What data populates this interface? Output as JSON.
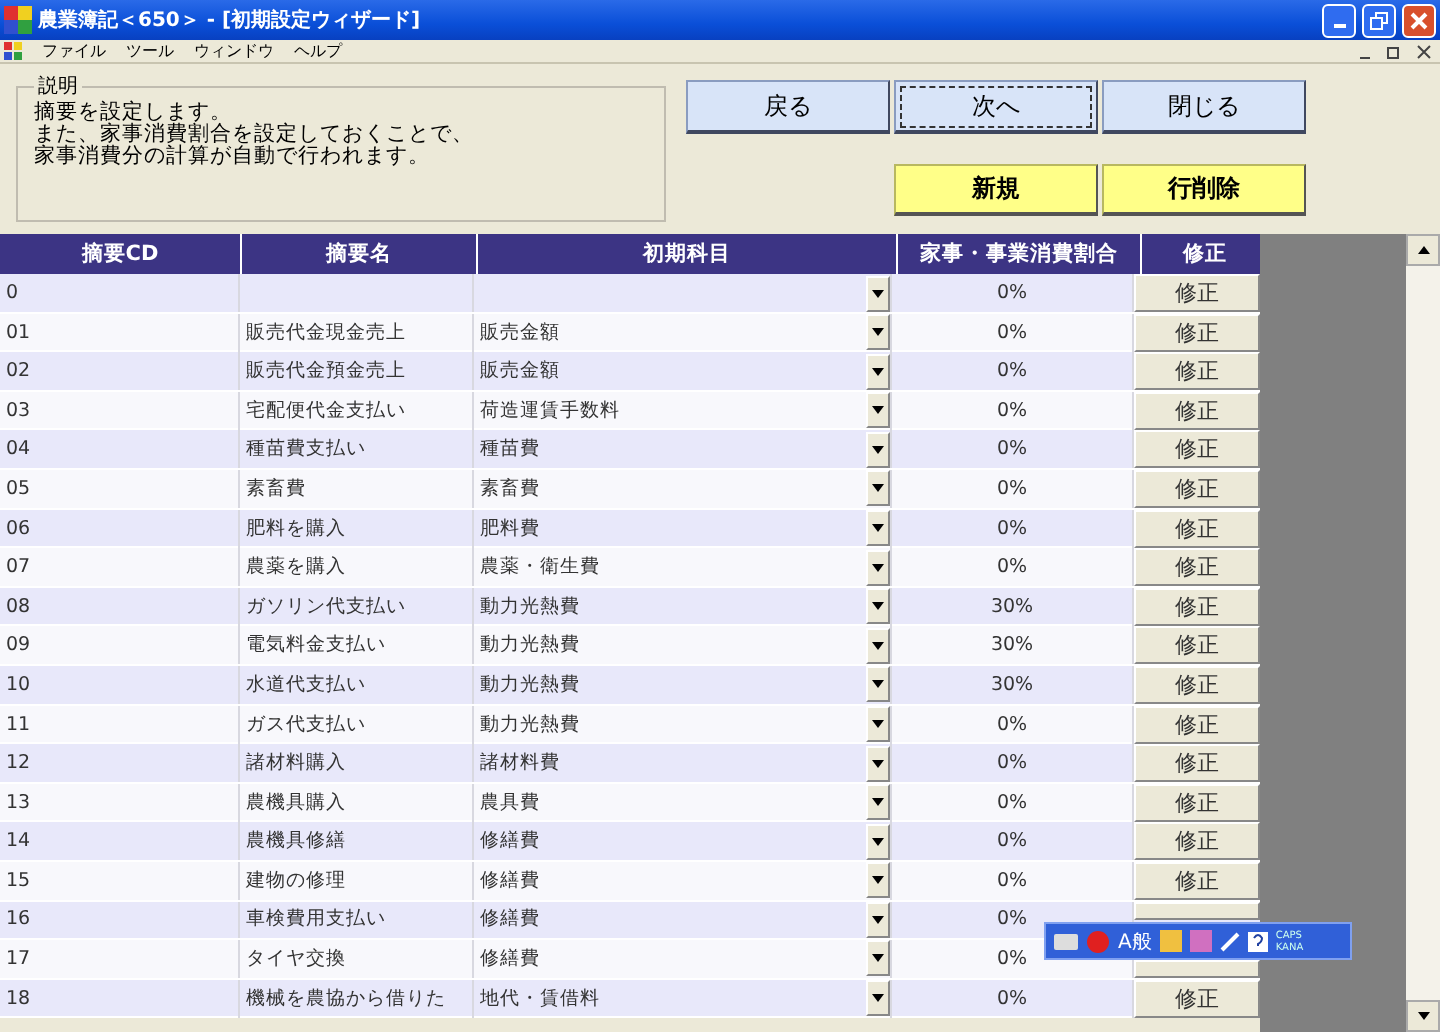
{
  "window": {
    "title": "農業簿記＜650＞ - [初期設定ウィザード]"
  },
  "menu": [
    "ファイル",
    "ツール",
    "ウィンドウ",
    "ヘルプ"
  ],
  "description": {
    "legend": "説明",
    "lines": [
      "摘要を設定します。",
      "また、家事消費割合を設定しておくことで、",
      "家事消費分の計算が自動で行われます。"
    ]
  },
  "nav_buttons": [
    {
      "label": "戻る",
      "focused": false
    },
    {
      "label": "次へ",
      "focused": true
    },
    {
      "label": "閉じる",
      "focused": false
    }
  ],
  "action_buttons": [
    "新規",
    "行削除"
  ],
  "table": {
    "columns": [
      "摘要CD",
      "摘要名",
      "初期科目",
      "家事・事業消費割合",
      "修正"
    ],
    "rows": [
      {
        "cd": "0",
        "name": "",
        "account": "",
        "ratio": "0%",
        "action": "修正"
      },
      {
        "cd": "01",
        "name": "販売代金現金売上",
        "account": "販売金額",
        "ratio": "0%",
        "action": "修正"
      },
      {
        "cd": "02",
        "name": "販売代金預金売上",
        "account": "販売金額",
        "ratio": "0%",
        "action": "修正"
      },
      {
        "cd": "03",
        "name": "宅配便代金支払い",
        "account": "荷造運賃手数料",
        "ratio": "0%",
        "action": "修正"
      },
      {
        "cd": "04",
        "name": "種苗費支払い",
        "account": "種苗費",
        "ratio": "0%",
        "action": "修正"
      },
      {
        "cd": "05",
        "name": "素畜費",
        "account": "素畜費",
        "ratio": "0%",
        "action": "修正"
      },
      {
        "cd": "06",
        "name": "肥料を購入",
        "account": "肥料費",
        "ratio": "0%",
        "action": "修正"
      },
      {
        "cd": "07",
        "name": "農薬を購入",
        "account": "農薬・衛生費",
        "ratio": "0%",
        "action": "修正"
      },
      {
        "cd": "08",
        "name": "ガソリン代支払い",
        "account": "動力光熱費",
        "ratio": "30%",
        "action": "修正"
      },
      {
        "cd": "09",
        "name": "電気料金支払い",
        "account": "動力光熱費",
        "ratio": "30%",
        "action": "修正"
      },
      {
        "cd": "10",
        "name": "水道代支払い",
        "account": "動力光熱費",
        "ratio": "30%",
        "action": "修正"
      },
      {
        "cd": "11",
        "name": "ガス代支払い",
        "account": "動力光熱費",
        "ratio": "0%",
        "action": "修正"
      },
      {
        "cd": "12",
        "name": "諸材料購入",
        "account": "諸材料費",
        "ratio": "0%",
        "action": "修正"
      },
      {
        "cd": "13",
        "name": "農機具購入",
        "account": "農具費",
        "ratio": "0%",
        "action": "修正"
      },
      {
        "cd": "14",
        "name": "農機具修繕",
        "account": "修繕費",
        "ratio": "0%",
        "action": "修正"
      },
      {
        "cd": "15",
        "name": "建物の修理",
        "account": "修繕費",
        "ratio": "0%",
        "action": "修正"
      },
      {
        "cd": "16",
        "name": "車検費用支払い",
        "account": "修繕費",
        "ratio": "0%"
      },
      {
        "cd": "17",
        "name": "タイヤ交換",
        "account": "修繕費",
        "ratio": "0%"
      },
      {
        "cd": "18",
        "name": "機械を農協から借りた",
        "account": "地代・賃借料",
        "ratio": "0%",
        "action": "修正"
      }
    ]
  },
  "language_bar": {
    "mode": "A般",
    "caps": "CAPS",
    "kana": "KANA"
  }
}
